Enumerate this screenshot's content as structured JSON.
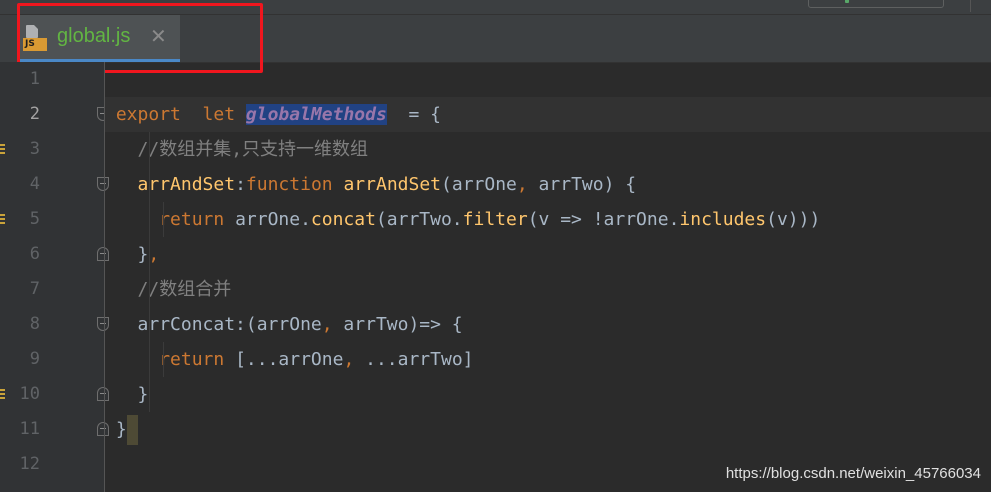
{
  "tab": {
    "label": "global.js",
    "icon": "js-file-icon",
    "badge_text": "JS",
    "close_glyph": "✕",
    "label_color": "#62b543"
  },
  "annotation": {
    "color": "#f0161e"
  },
  "lines": [
    {
      "n": "1",
      "tokens": []
    },
    {
      "n": "2",
      "tokens": [
        {
          "t": "export",
          "c": "kw"
        },
        {
          "t": "  let ",
          "c": "kw"
        },
        {
          "t": "globalMethods",
          "c": "var sel"
        },
        {
          "t": "  = {",
          "c": ""
        }
      ]
    },
    {
      "n": "3",
      "tokens": [
        {
          "t": "  //数组并集,只支持一维数组",
          "c": "cm"
        }
      ]
    },
    {
      "n": "4",
      "tokens": [
        {
          "t": "  ",
          "c": ""
        },
        {
          "t": "arrAndSet",
          "c": "fn"
        },
        {
          "t": ":",
          "c": ""
        },
        {
          "t": "function ",
          "c": "kw"
        },
        {
          "t": "arrAndSet",
          "c": "fn"
        },
        {
          "t": "(arrOne",
          "c": ""
        },
        {
          "t": ",",
          "c": "kw"
        },
        {
          "t": " arrTwo) {",
          "c": ""
        }
      ]
    },
    {
      "n": "5",
      "tokens": [
        {
          "t": "    ",
          "c": ""
        },
        {
          "t": "return ",
          "c": "kw"
        },
        {
          "t": "arrOne.",
          "c": ""
        },
        {
          "t": "concat",
          "c": "fn"
        },
        {
          "t": "(arrTwo.",
          "c": ""
        },
        {
          "t": "filter",
          "c": "fn"
        },
        {
          "t": "(v => !arrOne.",
          "c": ""
        },
        {
          "t": "includes",
          "c": "fn"
        },
        {
          "t": "(v)))",
          "c": ""
        }
      ]
    },
    {
      "n": "6",
      "tokens": [
        {
          "t": "  }",
          "c": ""
        },
        {
          "t": ",",
          "c": "kw"
        }
      ]
    },
    {
      "n": "7",
      "tokens": [
        {
          "t": "  //数组合并",
          "c": "cm"
        }
      ]
    },
    {
      "n": "8",
      "tokens": [
        {
          "t": "  arrConcat:(arrOne",
          "c": ""
        },
        {
          "t": ",",
          "c": "kw"
        },
        {
          "t": " arrTwo)=> {",
          "c": ""
        }
      ]
    },
    {
      "n": "9",
      "tokens": [
        {
          "t": "    ",
          "c": ""
        },
        {
          "t": "return ",
          "c": "kw"
        },
        {
          "t": "[...arrOne",
          "c": ""
        },
        {
          "t": ",",
          "c": "kw"
        },
        {
          "t": " ...arrTwo]",
          "c": ""
        }
      ]
    },
    {
      "n": "10",
      "tokens": [
        {
          "t": "  }",
          "c": ""
        }
      ]
    },
    {
      "n": "11",
      "tokens": [
        {
          "t": "}",
          "c": ""
        }
      ]
    },
    {
      "n": "12",
      "tokens": []
    }
  ],
  "current_line": "2",
  "watermark": "https://blog.csdn.net/weixin_45766034"
}
